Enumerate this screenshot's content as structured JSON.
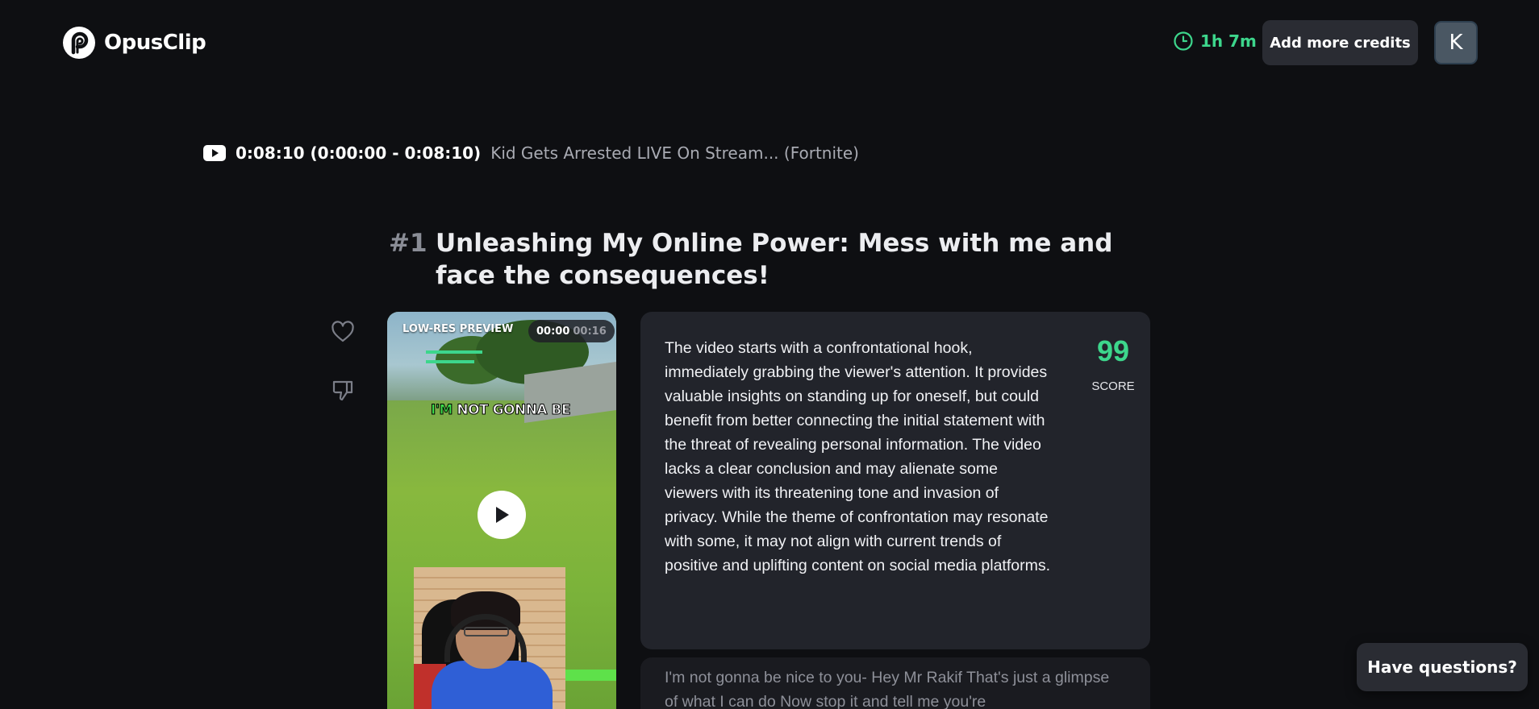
{
  "header": {
    "logo_text": "OpusClip",
    "credits_remaining": "1h 7m",
    "add_credits_label": "Add more credits",
    "avatar_initial": "K"
  },
  "source": {
    "duration_range": "0:08:10 (0:00:00 - 0:08:10)",
    "video_title": "Kid Gets Arrested LIVE On Stream... (Fortnite)"
  },
  "clip": {
    "number": "#1",
    "title": "Unleashing My Online Power: Mess with me and face the consequences!",
    "preview_label": "LOW-RES PREVIEW",
    "current_time": "00:00",
    "total_time": "00:16",
    "caption_highlight": "I'M",
    "caption_rest": "NOT GONNA BE",
    "analysis": "The video starts with a confrontational hook, immediately grabbing the viewer's attention. It provides valuable insights on standing up for oneself, but could benefit from better connecting the initial statement with the threat of revealing personal information. The video lacks a clear conclusion and may alienate some viewers with its threatening tone and invasion of privacy. While the theme of confrontation may resonate with some, it may not align with current trends of positive and uplifting content on social media platforms.",
    "score": "99",
    "score_label": "SCORE",
    "transcript": "I'm not gonna be nice to you- Hey Mr Rakif That's just a glimpse of what I can do Now stop it and tell me you're"
  },
  "help": {
    "label": "Have questions?"
  },
  "colors": {
    "background": "#0e0f12",
    "accent_green": "#3dd68c",
    "panel": "#22242b",
    "button": "#2a2c33"
  },
  "icons": {
    "logo": "opusclip-logo-icon",
    "credits": "clock-icon",
    "source": "youtube-icon",
    "like": "heart-icon",
    "dislike": "thumbs-down-icon",
    "play": "play-icon"
  }
}
